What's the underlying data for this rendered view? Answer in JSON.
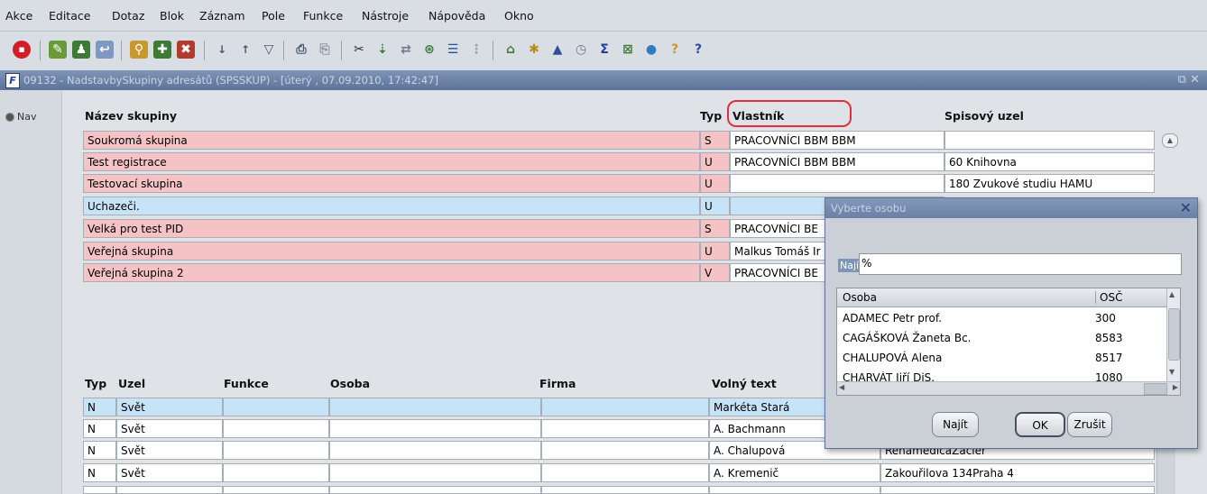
{
  "menu": [
    "Akce",
    "Editace",
    "Dotaz",
    "Blok",
    "Záznam",
    "Pole",
    "Funkce",
    "Nástroje",
    "Nápověda",
    "Okno"
  ],
  "window": {
    "title": "09132 - NadstavbySkupiny adresátů (SPSSKUP) - [úterý , 07.09.2010, 17:42:47]",
    "controls": "⧉ ✕"
  },
  "nav": {
    "label": "Nav"
  },
  "groups": {
    "headers": {
      "name": "Název skupiny",
      "type": "Typ",
      "owner": "Vlastník",
      "node": "Spisový uzel"
    },
    "rows": [
      {
        "name": "Soukromá skupina",
        "type": "S",
        "owner": "PRACOVNÍCI BBM BBM",
        "node": "",
        "color": "pink"
      },
      {
        "name": "Test registrace",
        "type": "U",
        "owner": "PRACOVNÍCI BBM BBM",
        "node": "60 Knihovna",
        "color": "pink"
      },
      {
        "name": "Testovací skupina",
        "type": "U",
        "owner": "",
        "node": "180 Zvukové studiu HAMU",
        "color": "pink"
      },
      {
        "name": "Uchazeči.",
        "type": "U",
        "owner": "",
        "node": "",
        "color": "blue"
      },
      {
        "name": "Velká pro test PID",
        "type": "S",
        "owner": "PRACOVNÍCI BE",
        "node": "",
        "color": "pink"
      },
      {
        "name": "Veřejná skupina",
        "type": "U",
        "owner": "Malkus Tomáš Ir",
        "node": "",
        "color": "pink"
      },
      {
        "name": "Veřejná skupina 2",
        "type": "V",
        "owner": "PRACOVNÍCI BE",
        "node": "",
        "color": "pink"
      }
    ]
  },
  "members": {
    "headers": {
      "type": "Typ",
      "node": "Uzel",
      "function": "Funkce",
      "person": "Osoba",
      "firm": "Firma",
      "freetext": "Volný text"
    },
    "rows": [
      {
        "type": "N",
        "node": "Svět",
        "freetext": "Markéta Stará",
        "extra": "",
        "color": "blue"
      },
      {
        "type": "N",
        "node": "Svět",
        "freetext": "A. Bachmann",
        "extra": "",
        "color": "white"
      },
      {
        "type": "N",
        "node": "Svět",
        "freetext": "A. Chalupová",
        "extra": "RehamedicaZacler",
        "color": "white"
      },
      {
        "type": "N",
        "node": "Svět",
        "freetext": "A. Kremenič",
        "extra": "Zakouřilova 134Praha 4",
        "color": "white"
      }
    ]
  },
  "dialog": {
    "title": "Vyberte osobu",
    "find_label": "Najít",
    "find_value": "%",
    "list_headers": {
      "person": "Osoba",
      "osc": "OSČ"
    },
    "list_rows": [
      {
        "person": "ADAMEC Petr prof.",
        "osc": "300"
      },
      {
        "person": "CAGÁŠKOVÁ Žaneta Bc.",
        "osc": "8583"
      },
      {
        "person": "CHALUPOVÁ Alena",
        "osc": "8517"
      },
      {
        "person": "CHARVÁT Jiří DiS.",
        "osc": "1080"
      }
    ],
    "buttons": {
      "find": "Najít",
      "ok": "OK",
      "cancel": "Zrušit"
    }
  }
}
